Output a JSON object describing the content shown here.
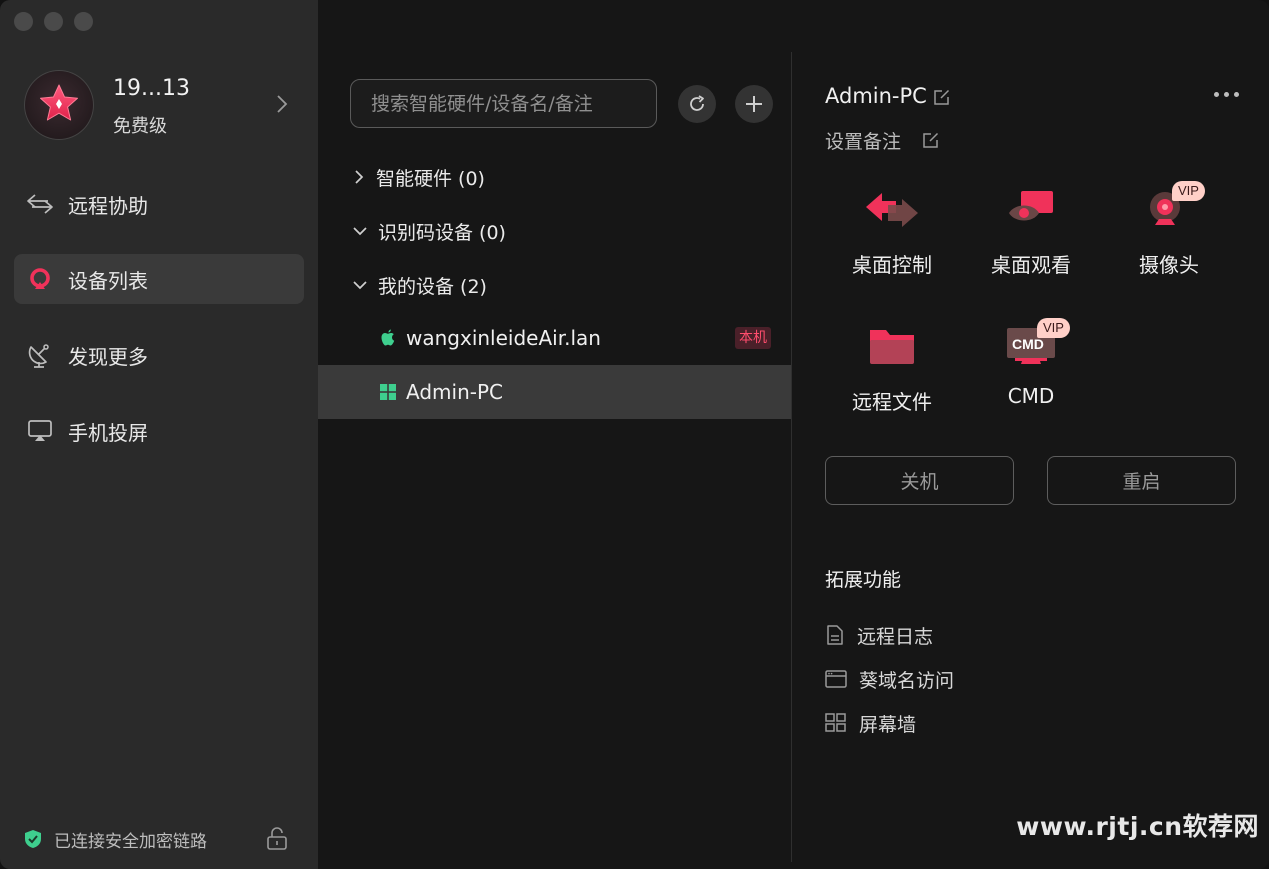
{
  "profile": {
    "name": "19...13",
    "tier": "免费级"
  },
  "nav": [
    {
      "label": "远程协助",
      "icon": "arrows-swap-icon"
    },
    {
      "label": "设备列表",
      "icon": "device-list-icon",
      "active": true
    },
    {
      "label": "发现更多",
      "icon": "satellite-dish-icon"
    },
    {
      "label": "手机投屏",
      "icon": "screen-cast-icon"
    }
  ],
  "status": {
    "text": "已连接安全加密链路"
  },
  "search": {
    "placeholder": "搜索智能硬件/设备名/备注"
  },
  "groups": [
    {
      "label": "智能硬件 (0)",
      "expanded": false
    },
    {
      "label": "识别码设备 (0)",
      "expanded": true
    },
    {
      "label": "我的设备 (2)",
      "expanded": true
    }
  ],
  "devices": [
    {
      "name": "wangxinleideAir.lan",
      "os": "apple",
      "badge": "本机"
    },
    {
      "name": "Admin-PC",
      "os": "windows",
      "selected": true
    }
  ],
  "detail": {
    "title": "Admin-PC",
    "remark": "设置备注",
    "features": [
      {
        "label": "桌面控制",
        "icon": "desktop-control-icon"
      },
      {
        "label": "桌面观看",
        "icon": "desktop-view-icon"
      },
      {
        "label": "摄像头",
        "icon": "camera-icon",
        "vip": "VIP"
      },
      {
        "label": "远程文件",
        "icon": "folder-icon"
      },
      {
        "label": "CMD",
        "icon": "cmd-icon",
        "vip": "VIP",
        "icon_text": "CMD"
      }
    ],
    "shutdown": "关机",
    "restart": "重启",
    "ext_title": "拓展功能",
    "ext_items": [
      "远程日志",
      "葵域名访问",
      "屏幕墙"
    ]
  },
  "watermark": "www.rjtj.cn软荐网",
  "colors": {
    "accent": "#f0325a",
    "green": "#3ecf8e",
    "sidebar": "#2a2a2a",
    "background": "#161616"
  }
}
